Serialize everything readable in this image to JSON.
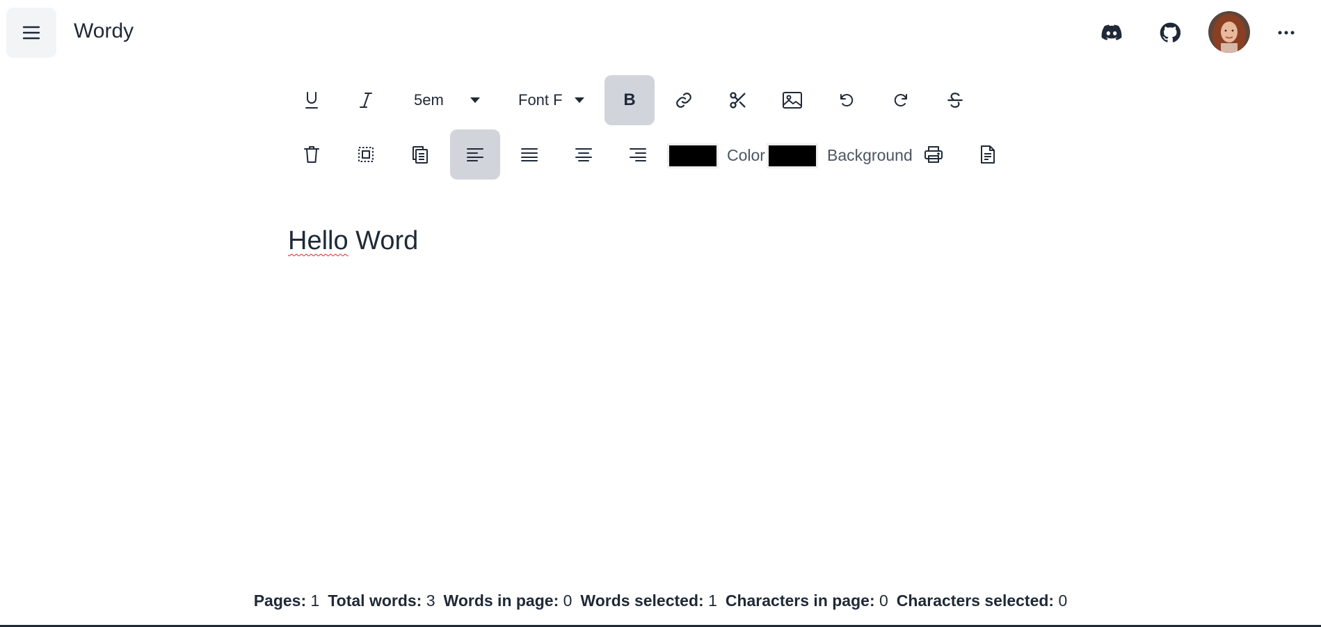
{
  "app": {
    "title": "Wordy"
  },
  "toolbar": {
    "font_size": "5em",
    "font_family": "Font F",
    "bold_label": "B",
    "color_label": "Color",
    "background_label": "Background",
    "text_color": "#000000",
    "background_color": "#000000"
  },
  "editor": {
    "word1": "Hello",
    "word2": "Word"
  },
  "status": [
    {
      "label": "Pages:",
      "value": "1"
    },
    {
      "label": "Total words:",
      "value": "3"
    },
    {
      "label": "Words in page:",
      "value": "0"
    },
    {
      "label": "Words selected:",
      "value": "1"
    },
    {
      "label": "Characters in page:",
      "value": "0"
    },
    {
      "label": "Characters selected:",
      "value": "0"
    }
  ],
  "icons": [
    "hamburger-icon",
    "discord-icon",
    "github-icon",
    "more-icon",
    "underline-icon",
    "italic-icon",
    "caret-down-icon",
    "link-icon",
    "scissors-icon",
    "image-icon",
    "undo-icon",
    "redo-icon",
    "strikethrough-icon",
    "trash-icon",
    "select-all-icon",
    "copy-icon",
    "align-left-icon",
    "justify-icon",
    "align-center-icon",
    "align-right-icon",
    "printer-icon",
    "document-icon"
  ],
  "colors": {
    "active_bg": "#d1d5db",
    "menu_bg": "#f3f4f6",
    "text": "#1f2937",
    "spell_error": "#dc2626"
  }
}
